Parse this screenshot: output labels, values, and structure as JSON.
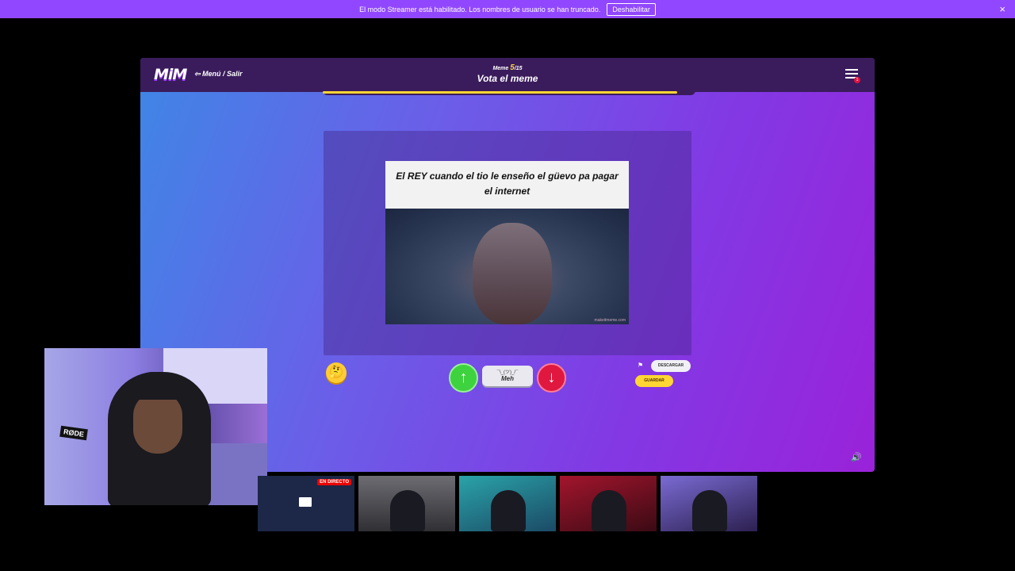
{
  "banner": {
    "message": "El modo Streamer está habilitado. Los nombres de usuario se han truncado.",
    "disable_label": "Deshabilitar",
    "close_symbol": "×"
  },
  "game": {
    "logo": "MiM",
    "menu_link": "Menú / Salir",
    "round_prefix": "Meme ",
    "round_current": "5",
    "round_total": "/15",
    "phase_title": "Vota el meme",
    "notification_count": "1",
    "timer_remaining": 0.95,
    "accent_color": "#ffd633"
  },
  "meme": {
    "caption": "El REY cuando el tio le enseño el güevo pa pagar el internet",
    "watermark": "makeitmeme.com"
  },
  "controls": {
    "emoji_button": "🤔",
    "vote_up_symbol": "↑",
    "meh_shrug": "¯\\_(ツ)_/¯",
    "meh_label": "Meh",
    "vote_down_symbol": "↓",
    "flag_symbol": "⚑",
    "download_label": "DESCARGAR",
    "save_label": "GUARDAR",
    "speaker_symbol": "🔊",
    "up_color": "#3ed23e",
    "down_color": "#e0173f"
  },
  "webcam": {
    "mic_brand": "RØDE"
  },
  "streams": {
    "live_badge": "EN DIRECTO"
  }
}
